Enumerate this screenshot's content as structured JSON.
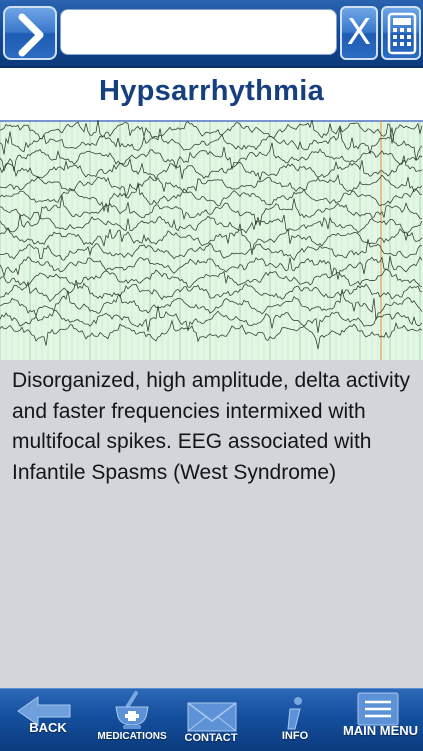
{
  "search": {
    "value": "",
    "placeholder": ""
  },
  "icons": {
    "go": "chevron-right-icon",
    "clear": "clear-x-icon",
    "calculator": "calculator-icon",
    "back": "back-arrow-icon",
    "medications": "mortar-pestle-icon",
    "contact": "envelope-icon",
    "info": "info-icon",
    "main_menu": "menu-list-icon"
  },
  "clear_label": "X",
  "title": "Hypsarrhythmia",
  "description": "Disorganized, high amplitude, delta activity and faster frequencies intermixed with multifocal spikes. EEG associated with Infantile Spasms (West Syndrome)",
  "nav": {
    "back": "BACK",
    "medications": "MEDICATIONS",
    "contact": "CONTACT",
    "info": "INFO",
    "main_menu": "MAIN MENU"
  },
  "colors": {
    "bar_blue": "#134c98",
    "title_blue": "#163f80",
    "eeg_background": "#e4f7e4",
    "page_background": "#d2d6da"
  }
}
